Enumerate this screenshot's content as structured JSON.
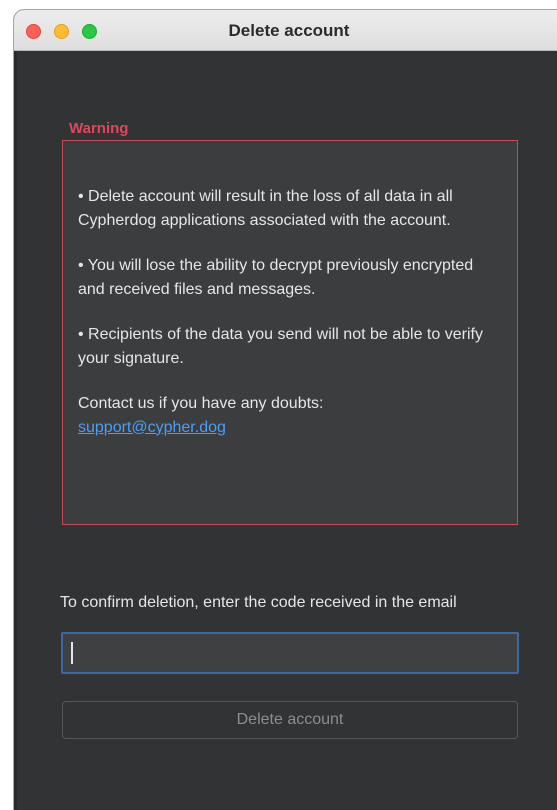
{
  "window": {
    "title": "Delete account"
  },
  "warning": {
    "heading": "Warning",
    "paragraphs": [
      "• Delete account will result in the loss of all data in all Cypherdog applications associated with the account.",
      "• You will lose the ability to decrypt previously encrypted and received files and messages.",
      "• Recipients of the data you send will not be able to verify your signature."
    ],
    "contact_text": "Contact us if you have any doubts:",
    "contact_link": "support@cypher.dog"
  },
  "confirm": {
    "label": "To confirm deletion, enter the code received in the email",
    "code_value": "",
    "code_placeholder": ""
  },
  "actions": {
    "delete_label": "Delete account"
  },
  "colors": {
    "background": "#323335",
    "warning_red": "#e0475a",
    "link_blue": "#4a9ef5",
    "input_focus": "#3e67a8"
  },
  "icons": {
    "close": "close-icon",
    "minimize": "minimize-icon",
    "zoom": "zoom-icon"
  }
}
